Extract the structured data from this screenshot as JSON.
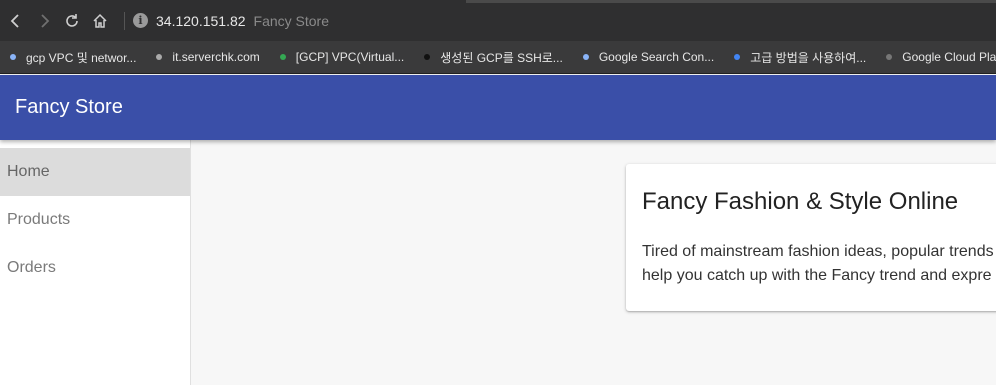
{
  "browser": {
    "url_host": "34.120.151.82",
    "page_title": "Fancy Store",
    "nav": [
      "back-icon",
      "forward-icon",
      "reload-icon",
      "home-icon"
    ]
  },
  "bookmarks": [
    {
      "label": "gcp VPC 및 networ...",
      "color": "#8ab4f8"
    },
    {
      "label": "it.serverchk.com",
      "color": "#aaaaaa"
    },
    {
      "label": "[GCP] VPC(Virtual...",
      "color": "#34a853"
    },
    {
      "label": "생성된 GCP를 SSH로...",
      "color": "#111111"
    },
    {
      "label": "Google Search Con...",
      "color": "#8ab4f8"
    },
    {
      "label": "고급 방법을 사용하여...",
      "color": "#4285f4"
    },
    {
      "label": "Google Cloud Platf...",
      "color": "#777777"
    }
  ],
  "header": {
    "title": "Fancy Store",
    "color": "#3a4fa8"
  },
  "sidebar": {
    "items": [
      {
        "label": "Home",
        "active": true
      },
      {
        "label": "Products",
        "active": false
      },
      {
        "label": "Orders",
        "active": false
      }
    ]
  },
  "card": {
    "title": "Fancy Fashion & Style Online",
    "line1": "Tired of mainstream fashion ideas, popular trends",
    "line2": "help you catch up with the Fancy trend and expre"
  }
}
